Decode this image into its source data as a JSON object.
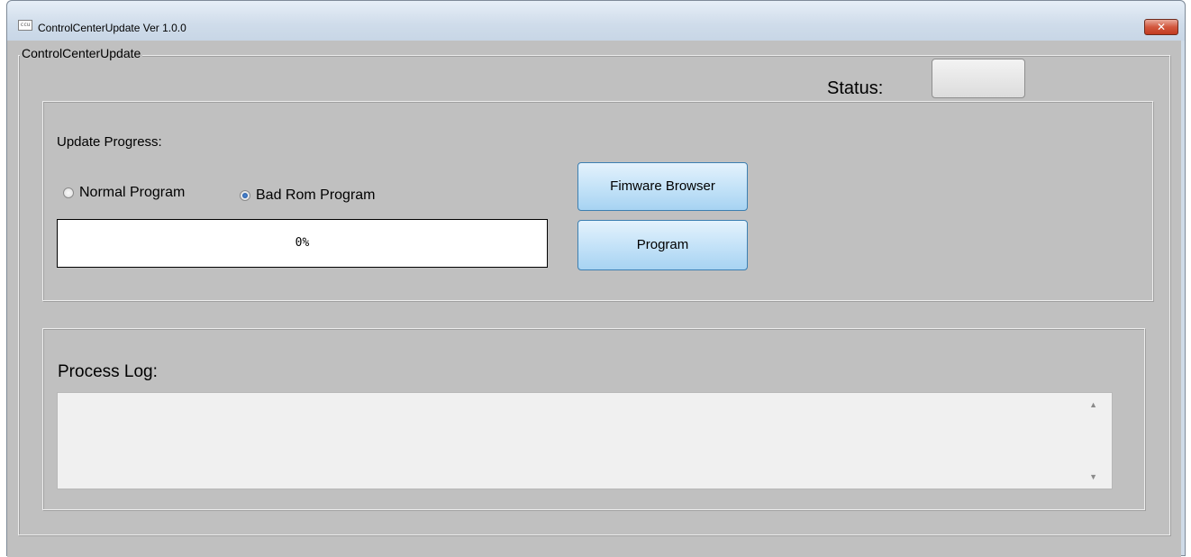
{
  "window": {
    "title": "ControlCenterUpdate  Ver 1.0.0",
    "icon": "app-icon",
    "close_label": "✕"
  },
  "main_group": {
    "label": "ControlCenterUpdate"
  },
  "status": {
    "label": "Status:",
    "color": "#e6e6e6"
  },
  "update": {
    "progress_label": "Update Progress:",
    "options": [
      {
        "label": "Normal Program",
        "checked": false
      },
      {
        "label": "Bad Rom Program",
        "checked": true
      }
    ],
    "progress_value": 0,
    "progress_text": "0%"
  },
  "buttons": {
    "firmware_browser": "Fimware Browser",
    "program": "Program"
  },
  "log": {
    "label": "Process Log:",
    "content": ""
  },
  "colors": {
    "button_face": "#c5e3f8",
    "button_border": "#3c7fb1",
    "panel": "#c0c0c0",
    "close_button": "#c23b20"
  }
}
